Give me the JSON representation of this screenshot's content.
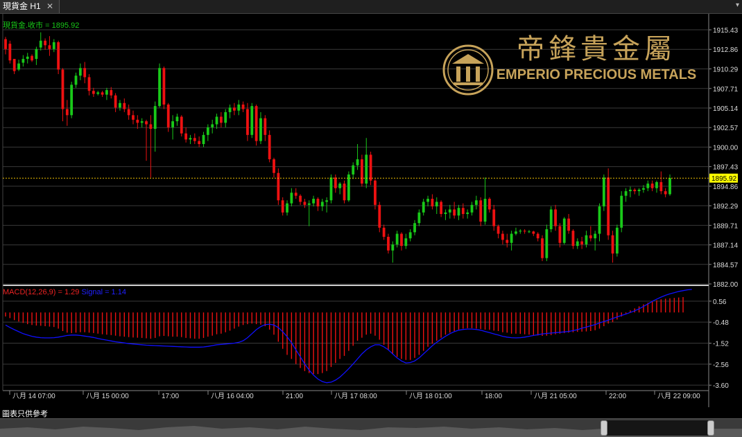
{
  "tab": {
    "title": "現貨金 H1",
    "close": "✕",
    "dropdown": "▾"
  },
  "main_panel": {
    "label": "現貨金.收市 = 1895.92",
    "current_price": "1895.92",
    "y_ticks": [
      "1915.43",
      "1912.86",
      "1910.29",
      "1907.71",
      "1905.14",
      "1902.57",
      "1900.00",
      "1897.43",
      "1894.86",
      "1892.29",
      "1889.71",
      "1887.14",
      "1884.57",
      "1882.00"
    ]
  },
  "macd_panel": {
    "label_macd": "MACD(12,26,9) = 1.29",
    "label_signal": "Signal = 1.14",
    "y_ticks": [
      "0.56",
      "-0.48",
      "-1.52",
      "-2.56",
      "-3.60"
    ]
  },
  "x_axis_labels": [
    "八月 14 07:00",
    "八月 15 00:00",
    "17:00",
    "八月 16 04:00",
    "21:00",
    "八月 17 08:00",
    "八月 18 01:00",
    "18:00",
    "八月 21 05:00",
    "22:00",
    "八月 22 09:00"
  ],
  "logo": {
    "chinese": "帝鋒貴金屬",
    "english": "EMPERIO PRECIOUS METALS"
  },
  "footer": {
    "note": "圖表只供參考"
  },
  "colors": {
    "up": "#19c919",
    "down": "#ee1111",
    "signal": "#1010ff",
    "price_line": "#f0c000",
    "gold": "#c7a35a"
  },
  "chart_data": {
    "type": "candlestick",
    "ylim": [
      1882.0,
      1916.8
    ],
    "candles": [
      [
        1914.2,
        1914.5,
        1912.2,
        1912.9
      ],
      [
        1913.6,
        1914.0,
        1911.0,
        1911.4
      ],
      [
        1911.6,
        1911.6,
        1909.6,
        1910.0
      ],
      [
        1910.2,
        1911.5,
        1910.0,
        1911.0
      ],
      [
        1911.1,
        1912.1,
        1910.6,
        1911.6
      ],
      [
        1911.6,
        1912.4,
        1911.0,
        1911.9
      ],
      [
        1912.0,
        1912.2,
        1911.2,
        1911.4
      ],
      [
        1911.6,
        1913.2,
        1910.8,
        1912.9
      ],
      [
        1913.1,
        1915.1,
        1912.7,
        1914.0
      ],
      [
        1914.0,
        1914.3,
        1912.8,
        1913.4
      ],
      [
        1913.4,
        1914.6,
        1912.0,
        1912.9
      ],
      [
        1912.9,
        1914.2,
        1912.5,
        1913.8
      ],
      [
        1913.8,
        1914.0,
        1909.6,
        1910.2
      ],
      [
        1910.2,
        1910.4,
        1903.4,
        1905.0
      ],
      [
        1905.0,
        1906.2,
        1902.8,
        1904.2
      ],
      [
        1904.2,
        1908.6,
        1903.8,
        1908.2
      ],
      [
        1908.2,
        1909.8,
        1907.8,
        1909.4
      ],
      [
        1909.4,
        1911.0,
        1908.8,
        1910.4
      ],
      [
        1910.4,
        1911.2,
        1908.4,
        1909.2
      ],
      [
        1909.2,
        1909.6,
        1906.8,
        1907.4
      ],
      [
        1907.4,
        1907.8,
        1906.6,
        1907.0
      ],
      [
        1907.0,
        1907.4,
        1906.8,
        1907.2
      ],
      [
        1907.2,
        1907.4,
        1906.6,
        1906.9
      ],
      [
        1906.9,
        1907.8,
        1906.2,
        1907.5
      ],
      [
        1907.5,
        1907.9,
        1906.4,
        1906.8
      ],
      [
        1906.8,
        1907.1,
        1904.6,
        1905.2
      ],
      [
        1905.2,
        1906.2,
        1904.8,
        1905.8
      ],
      [
        1905.8,
        1906.4,
        1904.6,
        1905.0
      ],
      [
        1905.0,
        1905.6,
        1903.6,
        1904.2
      ],
      [
        1904.2,
        1904.8,
        1903.0,
        1903.6
      ],
      [
        1903.6,
        1904.2,
        1902.4,
        1903.2
      ],
      [
        1903.2,
        1903.8,
        1902.6,
        1903.4
      ],
      [
        1903.4,
        1903.6,
        1898.2,
        1903.0
      ],
      [
        1903.0,
        1904.2,
        1896.0,
        1902.4
      ],
      [
        1902.4,
        1906.0,
        1899.4,
        1905.4
      ],
      [
        1905.4,
        1911.0,
        1905.2,
        1910.4
      ],
      [
        1910.4,
        1910.6,
        1905.0,
        1905.6
      ],
      [
        1905.6,
        1905.8,
        1902.0,
        1902.6
      ],
      [
        1902.6,
        1904.2,
        1901.0,
        1903.4
      ],
      [
        1903.4,
        1904.4,
        1902.8,
        1904.0
      ],
      [
        1904.0,
        1904.2,
        1901.4,
        1901.8
      ],
      [
        1901.8,
        1902.6,
        1900.6,
        1901.0
      ],
      [
        1901.0,
        1901.6,
        1900.4,
        1901.2
      ],
      [
        1901.2,
        1901.8,
        1900.4,
        1900.8
      ],
      [
        1900.8,
        1901.4,
        1900.0,
        1900.4
      ],
      [
        1900.4,
        1902.0,
        1900.0,
        1901.6
      ],
      [
        1901.6,
        1903.0,
        1900.8,
        1902.6
      ],
      [
        1902.6,
        1903.6,
        1901.8,
        1903.0
      ],
      [
        1903.0,
        1904.4,
        1902.4,
        1904.0
      ],
      [
        1904.0,
        1904.6,
        1902.6,
        1903.2
      ],
      [
        1903.2,
        1905.0,
        1902.6,
        1904.6
      ],
      [
        1904.6,
        1905.6,
        1903.8,
        1905.2
      ],
      [
        1905.2,
        1905.8,
        1904.2,
        1904.8
      ],
      [
        1904.8,
        1906.2,
        1904.2,
        1905.6
      ],
      [
        1905.6,
        1906.0,
        1904.6,
        1905.0
      ],
      [
        1905.0,
        1905.8,
        1900.8,
        1901.6
      ],
      [
        1901.6,
        1905.8,
        1901.2,
        1905.4
      ],
      [
        1905.4,
        1905.6,
        1900.2,
        1900.8
      ],
      [
        1900.8,
        1904.6,
        1900.4,
        1903.8
      ],
      [
        1903.8,
        1904.2,
        1900.8,
        1901.6
      ],
      [
        1901.6,
        1902.2,
        1898.0,
        1898.4
      ],
      [
        1898.4,
        1898.6,
        1896.0,
        1896.6
      ],
      [
        1896.6,
        1897.2,
        1892.4,
        1893.0
      ],
      [
        1893.0,
        1893.4,
        1891.0,
        1891.4
      ],
      [
        1891.4,
        1893.0,
        1891.0,
        1892.6
      ],
      [
        1892.6,
        1894.6,
        1892.2,
        1894.0
      ],
      [
        1894.0,
        1894.6,
        1893.2,
        1893.6
      ],
      [
        1893.6,
        1893.8,
        1892.4,
        1892.8
      ],
      [
        1892.8,
        1893.2,
        1892.0,
        1892.4
      ],
      [
        1892.4,
        1893.0,
        1889.6,
        1892.6
      ],
      [
        1892.6,
        1893.6,
        1892.2,
        1893.2
      ],
      [
        1893.2,
        1893.4,
        1891.6,
        1892.2
      ],
      [
        1892.2,
        1893.2,
        1891.6,
        1892.8
      ],
      [
        1892.8,
        1893.4,
        1891.4,
        1893.0
      ],
      [
        1893.0,
        1896.4,
        1892.6,
        1896.0
      ],
      [
        1896.0,
        1896.4,
        1894.0,
        1894.6
      ],
      [
        1894.6,
        1895.4,
        1893.8,
        1895.2
      ],
      [
        1895.2,
        1895.6,
        1892.6,
        1893.0
      ],
      [
        1893.0,
        1896.8,
        1892.8,
        1896.4
      ],
      [
        1896.4,
        1898.0,
        1895.8,
        1897.6
      ],
      [
        1897.6,
        1900.4,
        1897.0,
        1898.4
      ],
      [
        1898.4,
        1899.0,
        1894.8,
        1895.2
      ],
      [
        1895.2,
        1901.2,
        1894.6,
        1899.0
      ],
      [
        1899.0,
        1899.4,
        1895.0,
        1895.6
      ],
      [
        1895.6,
        1895.8,
        1891.8,
        1892.4
      ],
      [
        1892.4,
        1892.8,
        1888.8,
        1889.4
      ],
      [
        1889.4,
        1889.8,
        1887.8,
        1888.2
      ],
      [
        1888.2,
        1888.6,
        1886.0,
        1886.4
      ],
      [
        1886.4,
        1887.6,
        1884.8,
        1887.2
      ],
      [
        1887.2,
        1889.0,
        1886.8,
        1888.6
      ],
      [
        1888.6,
        1888.8,
        1886.4,
        1887.0
      ],
      [
        1887.0,
        1888.6,
        1886.6,
        1888.0
      ],
      [
        1888.0,
        1889.2,
        1887.6,
        1888.8
      ],
      [
        1888.8,
        1890.4,
        1888.4,
        1890.0
      ],
      [
        1890.0,
        1891.8,
        1889.6,
        1891.4
      ],
      [
        1891.4,
        1893.2,
        1891.0,
        1892.8
      ],
      [
        1892.8,
        1893.6,
        1892.2,
        1893.2
      ],
      [
        1893.2,
        1893.8,
        1891.8,
        1892.2
      ],
      [
        1892.2,
        1893.4,
        1891.2,
        1892.8
      ],
      [
        1892.8,
        1893.0,
        1890.8,
        1891.2
      ],
      [
        1891.2,
        1891.8,
        1890.4,
        1891.4
      ],
      [
        1891.4,
        1892.4,
        1890.6,
        1891.8
      ],
      [
        1891.8,
        1892.8,
        1890.6,
        1891.0
      ],
      [
        1891.0,
        1892.4,
        1890.4,
        1892.0
      ],
      [
        1892.0,
        1892.6,
        1890.6,
        1891.2
      ],
      [
        1891.2,
        1891.8,
        1890.6,
        1891.4
      ],
      [
        1891.4,
        1892.8,
        1891.0,
        1892.4
      ],
      [
        1892.4,
        1893.6,
        1891.8,
        1893.0
      ],
      [
        1893.0,
        1893.4,
        1889.6,
        1890.2
      ],
      [
        1890.2,
        1896.0,
        1889.8,
        1893.2
      ],
      [
        1893.2,
        1893.4,
        1891.4,
        1891.8
      ],
      [
        1891.8,
        1892.4,
        1889.0,
        1889.6
      ],
      [
        1889.6,
        1889.8,
        1888.0,
        1888.6
      ],
      [
        1888.6,
        1889.0,
        1887.2,
        1887.8
      ],
      [
        1887.8,
        1888.6,
        1886.8,
        1887.4
      ],
      [
        1887.4,
        1889.0,
        1886.4,
        1888.6
      ],
      [
        1888.6,
        1889.4,
        1888.4,
        1888.9
      ],
      [
        1888.9,
        1889.2,
        1888.6,
        1889.0
      ],
      [
        1889.0,
        1889.2,
        1888.6,
        1888.9
      ],
      [
        1888.9,
        1889.1,
        1888.7,
        1888.9
      ],
      [
        1888.9,
        1889.0,
        1888.3,
        1888.6
      ],
      [
        1888.6,
        1888.8,
        1887.6,
        1888.0
      ],
      [
        1888.0,
        1888.4,
        1885.0,
        1885.4
      ],
      [
        1885.4,
        1889.8,
        1885.0,
        1889.2
      ],
      [
        1889.2,
        1892.2,
        1888.8,
        1891.8
      ],
      [
        1891.8,
        1892.4,
        1889.0,
        1889.6
      ],
      [
        1889.6,
        1890.0,
        1886.8,
        1887.4
      ],
      [
        1887.4,
        1890.8,
        1887.2,
        1890.6
      ],
      [
        1890.6,
        1891.2,
        1888.6,
        1889.0
      ],
      [
        1889.0,
        1889.2,
        1886.6,
        1887.0
      ],
      [
        1887.0,
        1888.0,
        1886.6,
        1887.6
      ],
      [
        1887.6,
        1888.2,
        1886.6,
        1887.2
      ],
      [
        1887.2,
        1889.0,
        1886.8,
        1888.4
      ],
      [
        1888.4,
        1889.6,
        1887.6,
        1888.0
      ],
      [
        1888.0,
        1889.0,
        1886.4,
        1888.6
      ],
      [
        1888.6,
        1892.6,
        1887.6,
        1892.2
      ],
      [
        1892.2,
        1896.4,
        1891.6,
        1896.0
      ],
      [
        1896.0,
        1897.2,
        1887.8,
        1888.4
      ],
      [
        1888.4,
        1889.0,
        1884.8,
        1886.0
      ],
      [
        1886.0,
        1889.8,
        1885.6,
        1889.4
      ],
      [
        1889.4,
        1894.2,
        1888.8,
        1893.6
      ],
      [
        1893.6,
        1894.6,
        1892.8,
        1894.2
      ],
      [
        1894.2,
        1894.8,
        1893.4,
        1894.4
      ],
      [
        1894.4,
        1894.6,
        1893.8,
        1894.2
      ],
      [
        1894.2,
        1894.6,
        1893.6,
        1894.4
      ],
      [
        1894.4,
        1895.0,
        1894.0,
        1894.6
      ],
      [
        1894.6,
        1895.6,
        1894.2,
        1895.2
      ],
      [
        1895.2,
        1895.6,
        1894.2,
        1894.6
      ],
      [
        1894.6,
        1895.6,
        1894.0,
        1895.4
      ],
      [
        1895.4,
        1896.8,
        1893.8,
        1894.2
      ],
      [
        1894.2,
        1894.6,
        1893.4,
        1893.8
      ],
      [
        1893.8,
        1896.4,
        1893.6,
        1895.92
      ]
    ],
    "macd_ylim": [
      -3.8,
      1.0
    ],
    "macd_hist": [
      -0.2,
      -0.28,
      -0.38,
      -0.45,
      -0.52,
      -0.58,
      -0.62,
      -0.65,
      -0.66,
      -0.68,
      -0.7,
      -0.72,
      -0.8,
      -0.92,
      -1.0,
      -1.02,
      -1.0,
      -0.98,
      -0.98,
      -1.0,
      -1.02,
      -1.05,
      -1.08,
      -1.1,
      -1.12,
      -1.15,
      -1.18,
      -1.2,
      -1.22,
      -1.24,
      -1.25,
      -1.26,
      -1.28,
      -1.3,
      -1.26,
      -1.18,
      -1.16,
      -1.18,
      -1.2,
      -1.2,
      -1.22,
      -1.26,
      -1.28,
      -1.3,
      -1.3,
      -1.26,
      -1.2,
      -1.15,
      -1.08,
      -1.05,
      -0.98,
      -0.9,
      -0.8,
      -0.7,
      -0.62,
      -0.58,
      -0.55,
      -0.58,
      -0.6,
      -0.68,
      -0.85,
      -1.1,
      -1.45,
      -1.8,
      -2.1,
      -2.3,
      -2.55,
      -2.75,
      -2.9,
      -3.0,
      -3.05,
      -3.05,
      -3.0,
      -2.9,
      -2.7,
      -2.5,
      -2.3,
      -2.15,
      -1.9,
      -1.65,
      -1.4,
      -1.25,
      -1.1,
      -1.05,
      -1.15,
      -1.35,
      -1.6,
      -1.85,
      -2.05,
      -2.2,
      -2.3,
      -2.35,
      -2.35,
      -2.25,
      -2.1,
      -1.9,
      -1.7,
      -1.55,
      -1.4,
      -1.25,
      -1.1,
      -1.0,
      -0.92,
      -0.85,
      -0.8,
      -0.78,
      -0.78,
      -0.8,
      -0.82,
      -0.85,
      -0.86,
      -0.9,
      -0.92,
      -0.98,
      -1.0,
      -1.05,
      -1.05,
      -1.06,
      -1.08,
      -1.1,
      -1.12,
      -1.14,
      -1.16,
      -1.15,
      -1.12,
      -1.08,
      -1.05,
      -1.02,
      -1.0,
      -0.98,
      -0.96,
      -0.95,
      -0.94,
      -0.92,
      -0.88,
      -0.8,
      -0.68,
      -0.55,
      -0.48,
      -0.35,
      -0.2,
      -0.05,
      0.1,
      0.2,
      0.3,
      0.4,
      0.48,
      0.55,
      0.6,
      0.65,
      0.68,
      0.7,
      0.72,
      0.74,
      0.76
    ],
    "signal": [
      -0.62,
      -0.74,
      -0.85,
      -0.95,
      -1.05,
      -1.12,
      -1.18,
      -1.22,
      -1.25,
      -1.26,
      -1.26,
      -1.25,
      -1.22,
      -1.18,
      -1.14,
      -1.12,
      -1.12,
      -1.14,
      -1.17,
      -1.2,
      -1.24,
      -1.29,
      -1.33,
      -1.37,
      -1.41,
      -1.45,
      -1.48,
      -1.51,
      -1.54,
      -1.56,
      -1.58,
      -1.6,
      -1.62,
      -1.63,
      -1.64,
      -1.65,
      -1.66,
      -1.67,
      -1.68,
      -1.69,
      -1.7,
      -1.71,
      -1.72,
      -1.72,
      -1.72,
      -1.71,
      -1.68,
      -1.64,
      -1.6,
      -1.58,
      -1.56,
      -1.54,
      -1.52,
      -1.48,
      -1.4,
      -1.25,
      -1.05,
      -0.85,
      -0.7,
      -0.6,
      -0.58,
      -0.62,
      -0.75,
      -0.95,
      -1.2,
      -1.5,
      -1.85,
      -2.2,
      -2.55,
      -2.85,
      -3.1,
      -3.3,
      -3.42,
      -3.48,
      -3.45,
      -3.35,
      -3.2,
      -3.0,
      -2.78,
      -2.55,
      -2.3,
      -2.05,
      -1.85,
      -1.7,
      -1.6,
      -1.6,
      -1.7,
      -1.85,
      -2.05,
      -2.25,
      -2.4,
      -2.5,
      -2.48,
      -2.4,
      -2.25,
      -2.05,
      -1.85,
      -1.65,
      -1.48,
      -1.32,
      -1.18,
      -1.05,
      -0.95,
      -0.88,
      -0.84,
      -0.82,
      -0.82,
      -0.84,
      -0.88,
      -0.94,
      -1.0,
      -1.06,
      -1.12,
      -1.18,
      -1.22,
      -1.25,
      -1.26,
      -1.25,
      -1.22,
      -1.18,
      -1.14,
      -1.1,
      -1.06,
      -1.04,
      -1.02,
      -1.0,
      -0.98,
      -0.96,
      -0.94,
      -0.9,
      -0.85,
      -0.78,
      -0.72,
      -0.66,
      -0.6,
      -0.52,
      -0.45,
      -0.38,
      -0.3,
      -0.22,
      -0.15,
      -0.08,
      0.0,
      0.08,
      0.18,
      0.3,
      0.42,
      0.55,
      0.66,
      0.76,
      0.85,
      0.92,
      0.98,
      1.04,
      1.08,
      1.12,
      1.14
    ]
  }
}
